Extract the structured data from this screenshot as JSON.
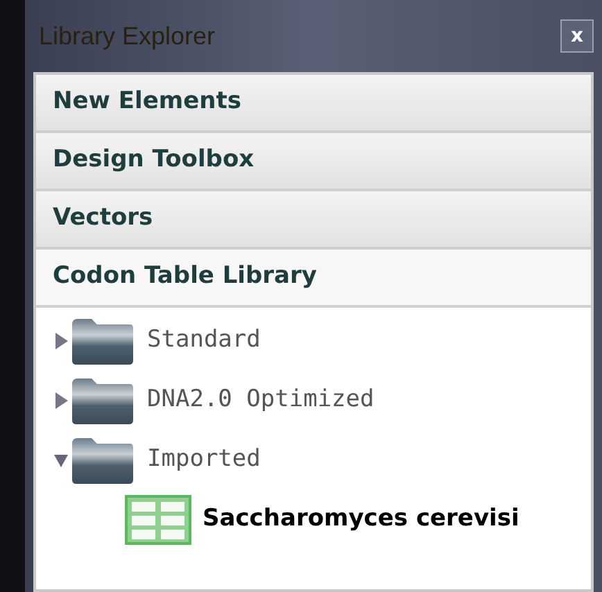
{
  "window": {
    "title": "Library Explorer",
    "close": "x"
  },
  "sections": [
    {
      "label": "New Elements",
      "expanded": false
    },
    {
      "label": "Design Toolbox",
      "expanded": false
    },
    {
      "label": "Vectors",
      "expanded": false
    },
    {
      "label": "Codon Table Library",
      "expanded": true
    }
  ],
  "tree": [
    {
      "kind": "folder",
      "label": "Standard",
      "expanded": false
    },
    {
      "kind": "folder",
      "label": "DNA2.0 Optimized",
      "expanded": false
    },
    {
      "kind": "folder",
      "label": "Imported",
      "expanded": true,
      "children": [
        {
          "kind": "table",
          "label": "Saccharomyces cerevisi"
        }
      ]
    }
  ]
}
